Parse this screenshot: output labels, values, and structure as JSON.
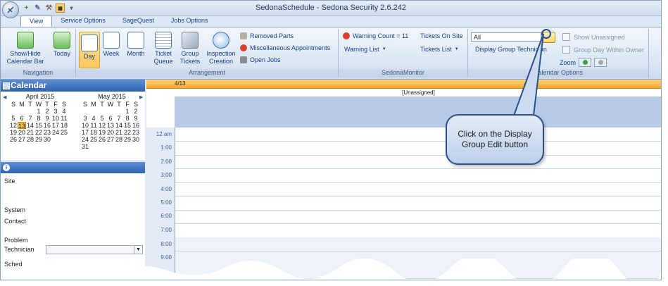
{
  "window": {
    "title": "SedonaSchedule - Sedona Security 2.6.242"
  },
  "tabs": [
    {
      "label": "View"
    },
    {
      "label": "Service Options"
    },
    {
      "label": "SageQuest"
    },
    {
      "label": "Jobs Options"
    }
  ],
  "ribbon": {
    "navigation": {
      "label": "Navigation",
      "show_hide": "Show/Hide",
      "calendar_bar": "Calendar Bar",
      "today": "Today"
    },
    "arrangement": {
      "label": "Arrangement",
      "day": "Day",
      "week": "Week",
      "month": "Month",
      "ticket": "Ticket",
      "queue": "Queue",
      "group": "Group",
      "tickets": "Tickets",
      "inspection": "Inspection",
      "creation": "Creation",
      "removed_parts": "Removed Parts",
      "misc_appointments": "Miscellaneous Appointments",
      "open_jobs": "Open Jobs"
    },
    "monitor": {
      "label": "SedonaMonitor",
      "warning_count": "Warning Count = 11",
      "warning_list": "Warning List",
      "tickets_on_site": "Tickets On Site",
      "tickets_list": "Tickets List"
    },
    "calendar_options": {
      "label": "Calendar Options",
      "group_value": "All",
      "display_group_technician": "Display Group Technician",
      "show_unassigned": "Show Unassigned",
      "group_day_within_owner": "Group Day Within Owner",
      "zoom": "Zoom"
    }
  },
  "calendar": {
    "title": "Calendar",
    "dow": [
      "S",
      "M",
      "T",
      "W",
      "T",
      "F",
      "S"
    ],
    "april": {
      "title": "April 2015",
      "weeks": [
        [
          "",
          "",
          "",
          "1",
          "2",
          "3",
          "4"
        ],
        [
          "5",
          "6",
          "7",
          "8",
          "9",
          "10",
          "11"
        ],
        [
          "12",
          "13",
          "14",
          "15",
          "16",
          "17",
          "18"
        ],
        [
          "19",
          "20",
          "21",
          "22",
          "23",
          "24",
          "25"
        ],
        [
          "26",
          "27",
          "28",
          "29",
          "30",
          "",
          ""
        ]
      ]
    },
    "may": {
      "title": "May 2015",
      "weeks": [
        [
          "",
          "",
          "",
          "",
          "",
          "1",
          "2"
        ],
        [
          "3",
          "4",
          "5",
          "6",
          "7",
          "8",
          "9"
        ],
        [
          "10",
          "11",
          "12",
          "13",
          "14",
          "15",
          "16"
        ],
        [
          "17",
          "18",
          "19",
          "20",
          "21",
          "22",
          "23"
        ],
        [
          "24",
          "25",
          "26",
          "27",
          "28",
          "29",
          "30"
        ],
        [
          "31",
          "",
          "",
          "",
          "",
          "",
          ""
        ]
      ]
    }
  },
  "info_fields": {
    "site": "Site",
    "system": "System",
    "contact": "Contact",
    "problem": "Problem",
    "technician": "Technician",
    "schedule": "Sched"
  },
  "schedule": {
    "date": "4/13",
    "resource": "[Unassigned]",
    "times": [
      "12 am",
      "1:00",
      "2:00",
      "3:00",
      "4:00",
      "5:00",
      "6:00",
      "7:00",
      "8:00",
      "9:00"
    ]
  },
  "callout": {
    "text": "Click on the Display Group Edit button"
  }
}
